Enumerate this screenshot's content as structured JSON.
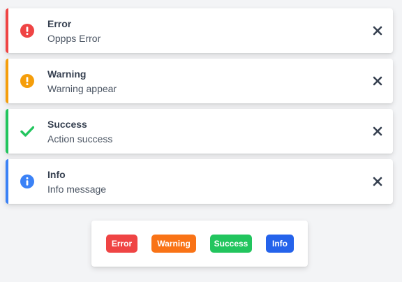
{
  "toasts": [
    {
      "title": "Error",
      "message": "Oppps Error",
      "color": "#ef4444",
      "icon": "error-icon"
    },
    {
      "title": "Warning",
      "message": "Warning appear",
      "color": "#f59e0b",
      "icon": "warning-icon"
    },
    {
      "title": "Success",
      "message": "Action success",
      "color": "#22c55e",
      "icon": "check-icon"
    },
    {
      "title": "Info",
      "message": "Info message",
      "color": "#3b82f6",
      "icon": "info-icon"
    }
  ],
  "close_icon": "close-icon",
  "buttons": [
    {
      "label": "Error",
      "color": "#ef4444"
    },
    {
      "label": "Warning",
      "color": "#f97316"
    },
    {
      "label": "Success",
      "color": "#22c55e"
    },
    {
      "label": "Info",
      "color": "#2563eb"
    }
  ]
}
